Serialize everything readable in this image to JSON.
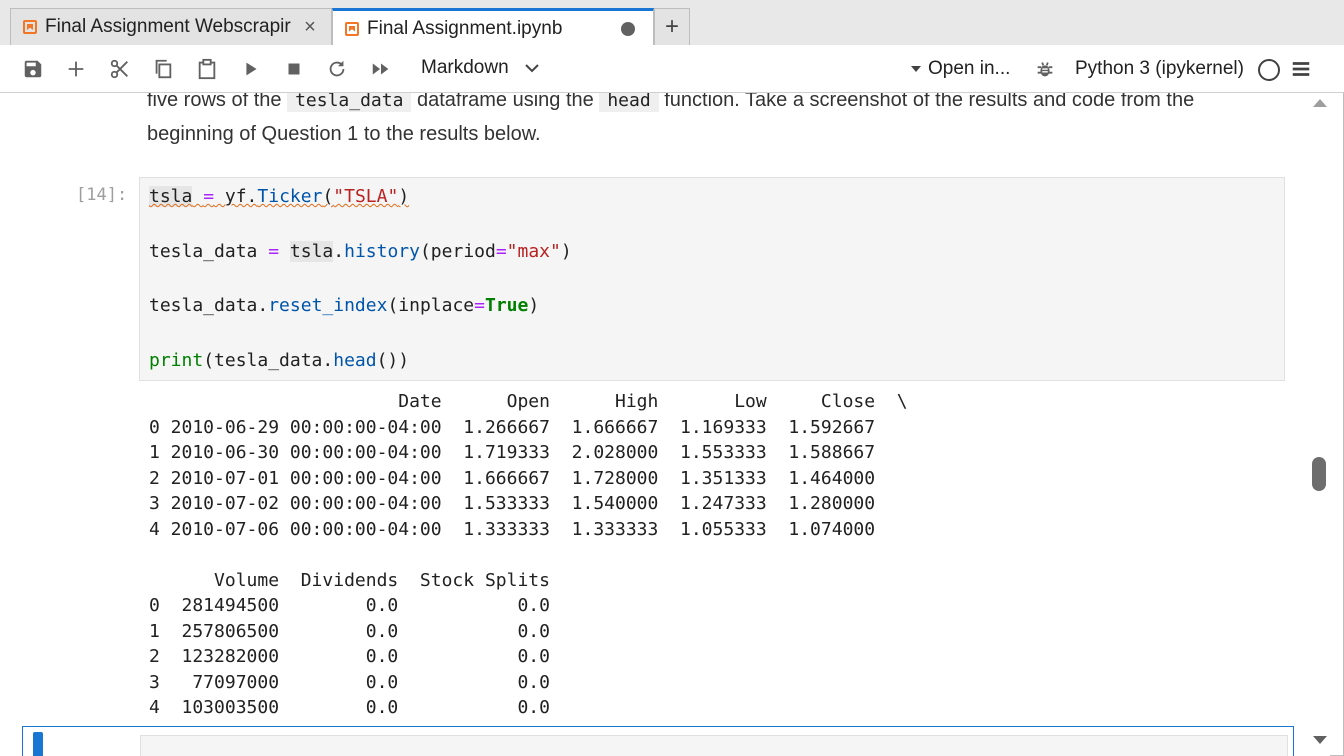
{
  "tabs": [
    {
      "label": "Final Assignment Webscrapir",
      "close": "×"
    },
    {
      "label": "Final Assignment.ipynb"
    }
  ],
  "tab_add": "+",
  "toolbar": {
    "cell_type": "Markdown",
    "open_in": "Open in...",
    "kernel": "Python 3 (ipykernel)"
  },
  "markdown": {
    "line1_a": "five rows of the ",
    "line1_code1": "tesla_data",
    "line1_b": " dataframe using the ",
    "line1_code2": "head",
    "line1_c": " function. Take a screenshot of the results and code from the",
    "line2": "beginning of Question 1 to the results below."
  },
  "cell": {
    "prompt": "[14]:",
    "code": {
      "l1_var": "tsla",
      "l1_rest1": " ",
      "l1_eq": "=",
      "l1_rest2": " yf.",
      "l1_fn": "Ticker",
      "l1_p1": "(",
      "l1_str": "\"TSLA\"",
      "l1_p2": ")",
      "l2_var": "tesla_data ",
      "l2_eq": "=",
      "l2_sp": " ",
      "l2_obj": "tsla",
      "l2_dot": ".",
      "l2_fn": "history",
      "l2_p1": "(period",
      "l2_eq2": "=",
      "l2_str": "\"max\"",
      "l2_p2": ")",
      "l3_var": "tesla_data.",
      "l3_fn": "reset_index",
      "l3_p1": "(inplace",
      "l3_eq": "=",
      "l3_true": "True",
      "l3_p2": ")",
      "l4_fn": "print",
      "l4_p1": "(tesla_data.",
      "l4_fn2": "head",
      "l4_p2": "())"
    },
    "output": "                       Date      Open      High       Low     Close  \\\n0 2010-06-29 00:00:00-04:00  1.266667  1.666667  1.169333  1.592667   \n1 2010-06-30 00:00:00-04:00  1.719333  2.028000  1.553333  1.588667   \n2 2010-07-01 00:00:00-04:00  1.666667  1.728000  1.351333  1.464000   \n3 2010-07-02 00:00:00-04:00  1.533333  1.540000  1.247333  1.280000   \n4 2010-07-06 00:00:00-04:00  1.333333  1.333333  1.055333  1.074000   \n\n      Volume  Dividends  Stock Splits  \n0  281494500        0.0           0.0  \n1  257806500        0.0           0.0  \n2  123282000        0.0           0.0  \n3   77097000        0.0           0.0  \n4  103003500        0.0           0.0  "
  },
  "colors": {
    "accent": "#1976d2",
    "notebook_icon": "#f37626"
  }
}
